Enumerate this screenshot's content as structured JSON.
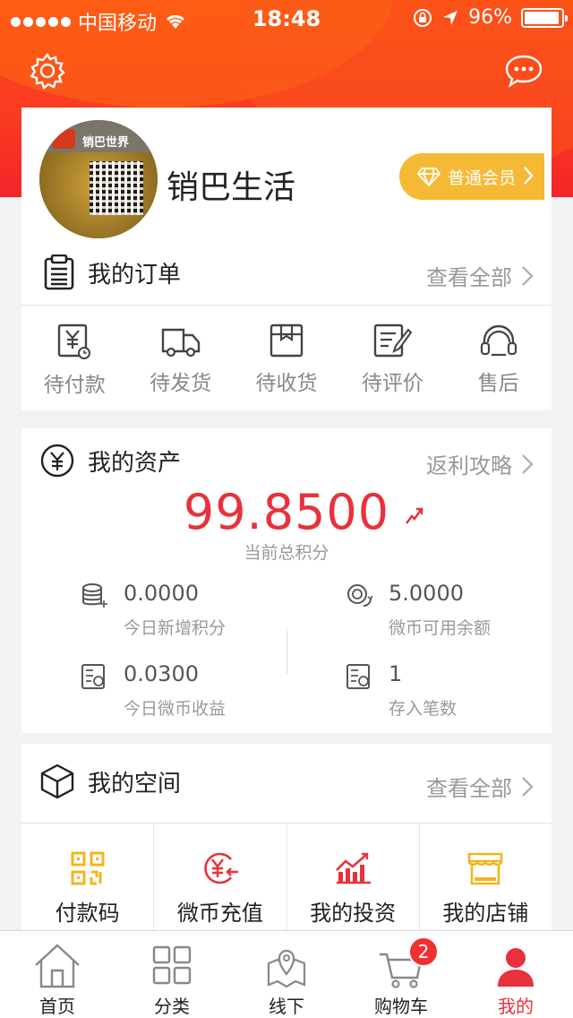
{
  "status_bar": {
    "carrier": "中国移动",
    "time": "18:48",
    "battery": "96%",
    "battery_level": 0.96
  },
  "header": {
    "settings_icon": "gear-icon",
    "message_icon": "chat-bubble-icon"
  },
  "profile": {
    "avatar_brand_text": "销巴世界",
    "name": "销巴生活",
    "membership_label": "普通会员"
  },
  "orders": {
    "title": "我的订单",
    "view_all": "查看全部",
    "items": [
      {
        "label": "待付款",
        "icon": "pending-payment-icon"
      },
      {
        "label": "待发货",
        "icon": "truck-icon"
      },
      {
        "label": "待收货",
        "icon": "package-icon"
      },
      {
        "label": "待评价",
        "icon": "review-icon"
      },
      {
        "label": "售后",
        "icon": "headset-icon"
      }
    ]
  },
  "assets": {
    "title": "我的资产",
    "link": "返利攻略",
    "total_points": "99.8500",
    "total_points_label": "当前总积分",
    "stats": [
      {
        "value": "0.0000",
        "label": "今日新增积分"
      },
      {
        "value": "5.0000",
        "label": "微币可用余额"
      },
      {
        "value": "0.0300",
        "label": "今日微币收益"
      },
      {
        "value": "1",
        "label": "存入笔数"
      }
    ]
  },
  "space": {
    "title": "我的空间",
    "view_all": "查看全部",
    "items": [
      {
        "label": "付款码",
        "icon": "qr-code-icon"
      },
      {
        "label": "微币充值",
        "icon": "coin-recharge-icon"
      },
      {
        "label": "我的投资",
        "icon": "investment-chart-icon"
      },
      {
        "label": "我的店铺",
        "icon": "store-icon"
      }
    ]
  },
  "tabbar": {
    "items": [
      {
        "label": "首页",
        "icon": "home-icon"
      },
      {
        "label": "分类",
        "icon": "grid-icon"
      },
      {
        "label": "线下",
        "icon": "map-pin-icon"
      },
      {
        "label": "购物车",
        "icon": "cart-icon",
        "badge": "2"
      },
      {
        "label": "我的",
        "icon": "person-icon",
        "active": true
      }
    ]
  },
  "colors": {
    "header": "#f93a22",
    "accent_red": "#e8323b",
    "vip_gold": "#f6b935",
    "space_yellow": "#f2b51f"
  }
}
